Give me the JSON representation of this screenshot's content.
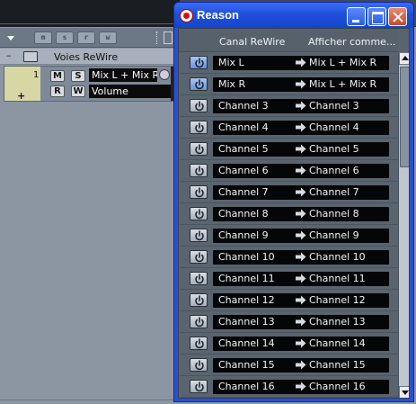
{
  "background_project": {
    "toolbar_buttons": [
      "m",
      "s",
      "r",
      "w"
    ],
    "inspector_header_label": "Voies ReWire",
    "track": {
      "number": "1",
      "mute_label": "M",
      "solo_label": "S",
      "read_label": "R",
      "write_label": "W",
      "channel_value": "Mix L + Mix R",
      "automation_value": "Volume"
    }
  },
  "reason_window": {
    "title": "Reason",
    "columns": {
      "canal": "Canal ReWire",
      "affichage": "Afficher comme..."
    },
    "rows": [
      {
        "source": "Mix L",
        "display": "Mix L + Mix R",
        "active": true
      },
      {
        "source": "Mix R",
        "display": "Mix L + Mix R",
        "active": true
      },
      {
        "source": "Channel 3",
        "display": "Channel 3",
        "active": false
      },
      {
        "source": "Channel 4",
        "display": "Channel 4",
        "active": false
      },
      {
        "source": "Channel 5",
        "display": "Channel 5",
        "active": false
      },
      {
        "source": "Channel 6",
        "display": "Channel 6",
        "active": false
      },
      {
        "source": "Channel 7",
        "display": "Channel 7",
        "active": false
      },
      {
        "source": "Channel 8",
        "display": "Channel 8",
        "active": false
      },
      {
        "source": "Channel 9",
        "display": "Channel 9",
        "active": false
      },
      {
        "source": "Channel 10",
        "display": "Channel 10",
        "active": false
      },
      {
        "source": "Channel 11",
        "display": "Channel 11",
        "active": false
      },
      {
        "source": "Channel 12",
        "display": "Channel 12",
        "active": false
      },
      {
        "source": "Channel 13",
        "display": "Channel 13",
        "active": false
      },
      {
        "source": "Channel 14",
        "display": "Channel 14",
        "active": false
      },
      {
        "source": "Channel 15",
        "display": "Channel 15",
        "active": false
      },
      {
        "source": "Channel 16",
        "display": "Channel 16",
        "active": false
      }
    ]
  },
  "colors": {
    "titlebar_blue": "#1f50dc",
    "panel_gray": "#59646f",
    "field_black": "#050608",
    "active_power_blue": "#6b93d8"
  },
  "icons": {
    "power": "power-icon",
    "arrow": "right-arrow-icon",
    "app": "reason-app-icon"
  }
}
